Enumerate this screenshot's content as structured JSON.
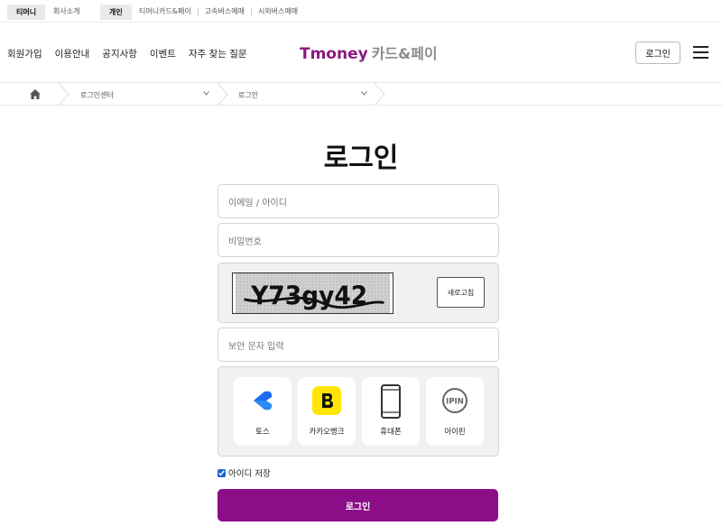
{
  "topbar": {
    "brand_pill": "티머니",
    "company_link": "회사소개",
    "personal_pill": "개인",
    "links": [
      "티머니카드&페이",
      "고속버스예매",
      "시외버스예매"
    ]
  },
  "header": {
    "nav": [
      "회원가입",
      "이용안내",
      "공지사항",
      "이벤트",
      "자주 찾는 질문"
    ],
    "logo_brand": "Tmoney",
    "logo_suffix": "카드&페이",
    "login_button": "로그인",
    "menu_icon": "hamburger-icon"
  },
  "breadcrumb": {
    "home_icon": "home-icon",
    "level1": "로그인센터",
    "level2": "로그인"
  },
  "login": {
    "title": "로그인",
    "id_placeholder": "이메일 / 아이디",
    "password_placeholder": "비밀번호",
    "captcha_text": "Y73gy42",
    "refresh_label": "새로고침",
    "captcha_input_placeholder": "보안 문자 입력",
    "auth_methods": [
      {
        "label": "토스",
        "icon": "toss-icon"
      },
      {
        "label": "카카오뱅크",
        "icon": "kakaobank-icon"
      },
      {
        "label": "휴대폰",
        "icon": "mobile-phone-icon"
      },
      {
        "label": "아이핀",
        "icon": "ipin-icon"
      }
    ],
    "remember_label": "아이디 저장",
    "remember_checked": true,
    "submit_label": "로그인"
  },
  "colors": {
    "brand": "#8c0d88",
    "logo_tmoney": "#8a1a7e",
    "kakao_yellow": "#ffe500",
    "toss_blue": "#1a6cf0"
  }
}
